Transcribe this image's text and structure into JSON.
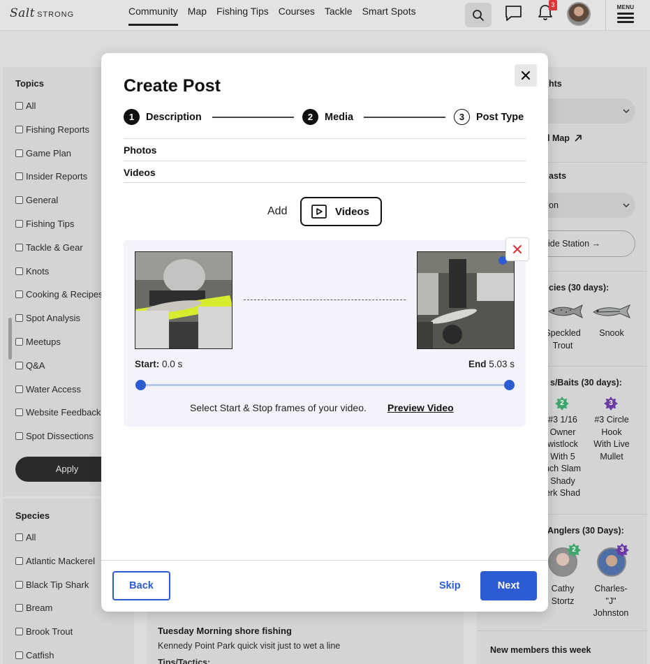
{
  "topnav": {
    "logo_script": "Salt",
    "logo_word": "STRONG",
    "links": [
      "Community",
      "Map",
      "Fishing Tips",
      "Courses",
      "Tackle",
      "Smart Spots"
    ],
    "active_link": "Community",
    "notification_count": "3",
    "menu_label": "MENU"
  },
  "left_sidebar": {
    "topics_heading": "Topics",
    "topics": [
      "All",
      "Fishing Reports",
      "Game Plan",
      "Insider Reports",
      "General",
      "Fishing Tips",
      "Tackle & Gear",
      "Knots",
      "Cooking & Recipes",
      "Spot Analysis",
      "Meetups",
      "Q&A",
      "Water Access",
      "Website Feedback",
      "Spot Dissections"
    ],
    "apply_label": "Apply",
    "species_heading": "Species",
    "species": [
      "All",
      "Atlantic Mackerel",
      "Black Tip Shark",
      "Bream",
      "Brook Trout",
      "Catfish"
    ]
  },
  "feed": {
    "post_title": "Tuesday Morning shore fishing",
    "post_text": "Kennedy Point Park quick visit just to wet a line",
    "post_cut": "Tips/Tactics:"
  },
  "right_sidebar": {
    "spots_heading_partial": "hts",
    "map_link_partial": "l Map",
    "forecasts_heading_partial": "asts",
    "select_partial": "on",
    "tide_button_partial": "ide Station →",
    "species_heading_partial": "cies (30 days):",
    "species_1": "Speckled Trout",
    "species_2": "Snook",
    "lures_heading_partial": "s/Baits (30 days):",
    "lure_1": "#3 1/16 Owner wistlock With 5 nch Slam Shady erk Shad",
    "lure_1_lines": [
      "#3 1/16",
      "Owner",
      "wistlock",
      "With 5",
      "nch Slam",
      "Shady",
      "erk Shad"
    ],
    "lure_1_badge": "2",
    "lure_2_lines": [
      "#3 Circle",
      "Hook",
      "With Live",
      "Mullet"
    ],
    "lure_2_badge": "3",
    "anglers_heading_partial": "Anglers (30 Days):",
    "angler_1_lines": [
      "Cathy",
      "Stortz"
    ],
    "angler_1_badge": "2",
    "angler_2_lines": [
      "Charles-",
      "\"J\"",
      "Johnston"
    ],
    "angler_2_badge": "3",
    "new_members": "New members this week",
    "colors": {
      "badge_green": "#3fa66b",
      "badge_purple": "#6b3aa6"
    }
  },
  "modal": {
    "title": "Create Post",
    "steps": [
      {
        "num": "1",
        "label": "Description",
        "state": "done"
      },
      {
        "num": "2",
        "label": "Media",
        "state": "current"
      },
      {
        "num": "3",
        "label": "Post Type",
        "state": "upcoming"
      }
    ],
    "sections": [
      "Photos",
      "Videos"
    ],
    "add_label": "Add",
    "videos_button": "Videos",
    "video": {
      "start_label": "Start:",
      "start_value": "0.0 s",
      "end_label": "End",
      "end_value": "5.03 s",
      "range_start_fraction": 0.0,
      "range_end_fraction": 1.0,
      "helper_text": "Select Start & Stop frames of your video.",
      "preview_link": "Preview Video"
    },
    "back_label": "Back",
    "skip_label": "Skip",
    "next_label": "Next",
    "colors": {
      "primary": "#2d5bd1",
      "track": "#b8c7ee",
      "remove_x": "#d2323c",
      "panel_bg": "#f3f4fb"
    }
  }
}
